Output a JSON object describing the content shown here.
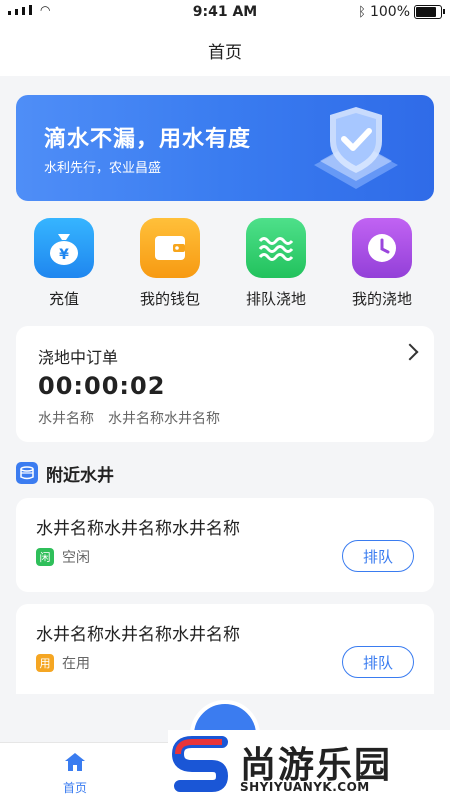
{
  "status_bar": {
    "time": "9:41 AM",
    "battery": "100%"
  },
  "nav": {
    "title": "首页"
  },
  "banner": {
    "title": "滴水不漏，用水有度",
    "subtitle": "水利先行，农业昌盛"
  },
  "actions": [
    {
      "label": "充值",
      "icon": "money-bag-icon",
      "color": "#2f9bf0"
    },
    {
      "label": "我的钱包",
      "icon": "wallet-icon",
      "color": "#f7a51c"
    },
    {
      "label": "排队浇地",
      "icon": "water-waves-icon",
      "color": "#2fcf6a"
    },
    {
      "label": "我的浇地",
      "icon": "clock-icon",
      "color": "#a64de0"
    }
  ],
  "order": {
    "title": "浇地中订单",
    "time": "00:00:02",
    "well_label": "水井名称",
    "well_value": "水井名称水井名称"
  },
  "nearby": {
    "title": "附近水井"
  },
  "wells": [
    {
      "name": "水井名称水井名称水井名称",
      "badge": "闲",
      "badge_color": "#2fbf5a",
      "status": "空闲",
      "button": "排队"
    },
    {
      "name": "水井名称水井名称水井名称",
      "badge": "用",
      "badge_color": "#f5a623",
      "status": "在用",
      "button": "排队"
    }
  ],
  "tabbar": {
    "home_label": "首页"
  },
  "watermark": {
    "cn": "尚游乐园",
    "en": "SHYIYUANYK.COM"
  }
}
